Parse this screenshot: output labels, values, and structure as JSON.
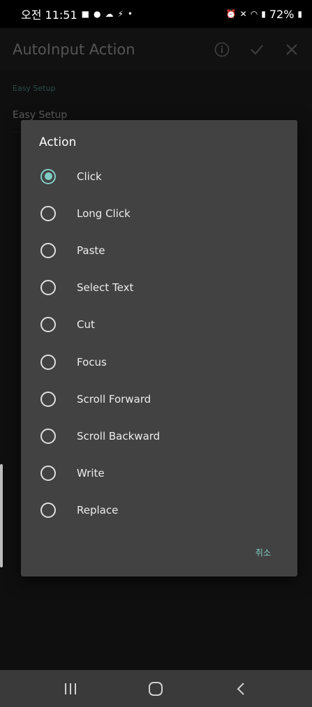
{
  "status_bar": {
    "time": "오전 11:51",
    "battery": "72%",
    "left_icons": [
      "chat-bubble-icon",
      "talk-icon",
      "message-icon",
      "weather-icon",
      "flash-icon",
      "dot-icon"
    ],
    "right_icons": [
      "alarm-icon",
      "mute-icon",
      "wifi-icon",
      "signal-icon",
      "battery-icon"
    ]
  },
  "app": {
    "title": "AutoInput Action",
    "section_easy": "Easy Setup",
    "easy_setup_title": "Easy Setup"
  },
  "dialog": {
    "title": "Action",
    "options": [
      {
        "label": "Click",
        "selected": true
      },
      {
        "label": "Long Click",
        "selected": false
      },
      {
        "label": "Paste",
        "selected": false
      },
      {
        "label": "Select Text",
        "selected": false
      },
      {
        "label": "Cut",
        "selected": false
      },
      {
        "label": "Focus",
        "selected": false
      },
      {
        "label": "Scroll Forward",
        "selected": false
      },
      {
        "label": "Scroll Backward",
        "selected": false
      },
      {
        "label": "Write",
        "selected": false
      },
      {
        "label": "Replace",
        "selected": false
      }
    ],
    "cancel_label": "취소"
  },
  "colors": {
    "accent": "#80cbc4",
    "dialog_bg": "#424242",
    "nav_bg": "#3a3a3a"
  }
}
